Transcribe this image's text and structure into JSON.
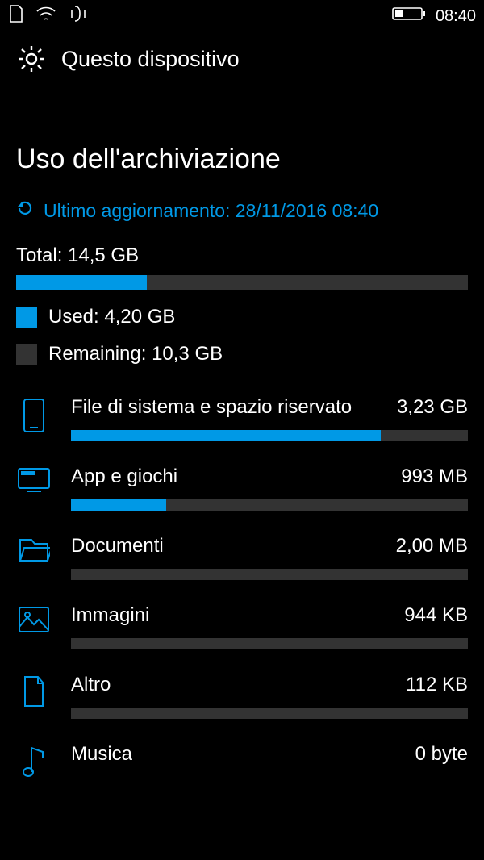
{
  "status_bar": {
    "time": "08:40"
  },
  "header": {
    "title": "Questo dispositivo"
  },
  "page": {
    "title": "Uso dell'archiviazione",
    "last_update_label": "Ultimo aggiornamento: 28/11/2016 08:40"
  },
  "totals": {
    "total_label": "Total: 14,5 GB",
    "used_label": "Used: 4,20 GB",
    "remaining_label": "Remaining: 10,3 GB",
    "total_fill_percent": 29
  },
  "categories": [
    {
      "icon": "phone",
      "name": "File di sistema e spazio riservato",
      "size": "3,23 GB",
      "fill": 78
    },
    {
      "icon": "apps",
      "name": "App e giochi",
      "size": "993 MB",
      "fill": 24
    },
    {
      "icon": "docs",
      "name": "Documenti",
      "size": "2,00 MB",
      "fill": 0
    },
    {
      "icon": "images",
      "name": "Immagini",
      "size": "944 KB",
      "fill": 0
    },
    {
      "icon": "other",
      "name": "Altro",
      "size": "112 KB",
      "fill": 0
    },
    {
      "icon": "music",
      "name": "Musica",
      "size": "0 byte",
      "fill": 0
    }
  ],
  "colors": {
    "accent": "#0099e6",
    "bar_bg": "#333333"
  }
}
